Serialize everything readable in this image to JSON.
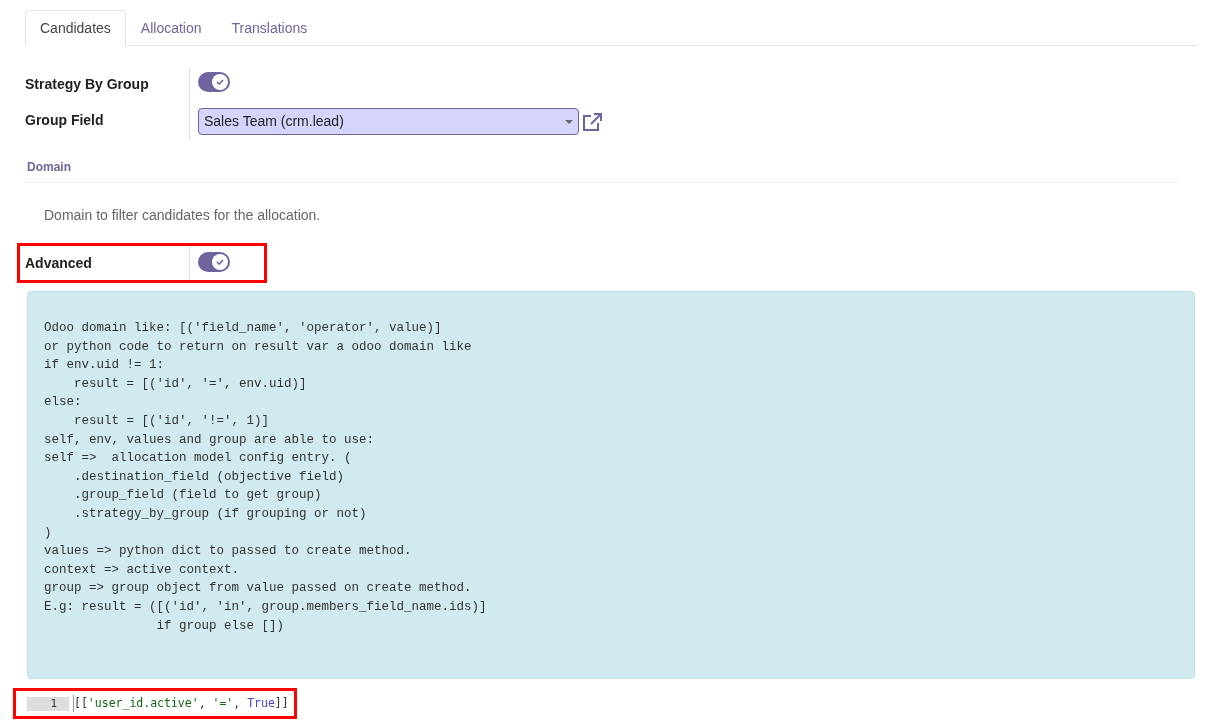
{
  "tabs": [
    {
      "label": "Candidates",
      "selected": true
    },
    {
      "label": "Allocation",
      "selected": false
    },
    {
      "label": "Translations",
      "selected": false
    }
  ],
  "fields": [
    {
      "label": "Strategy By Group",
      "kind": "toggle",
      "on": true
    },
    {
      "label": "Group Field",
      "kind": "select",
      "value": "Sales Team (crm.lead)"
    }
  ],
  "domain_section": {
    "title": "Domain",
    "description": "Domain to filter candidates for the allocation.",
    "advanced": {
      "label": "Advanced",
      "on": true
    },
    "help_lines": [
      "Odoo domain like: [('field_name', 'operator', value)]",
      "or python code to return on result var a odoo domain like",
      "if env.uid != 1:",
      "    result = [('id', '=', env.uid)]",
      "else:",
      "    result = [('id', '!=', 1)]",
      "self, env, values and group are able to use:",
      "self =>  allocation model config entry. (",
      "    .destination_field (objective field)",
      "    .group_field (field to get group)",
      "    .strategy_by_group (if grouping or not)",
      ")",
      "values => python dict to passed to create method.",
      "context => active context.",
      "group => group object from value passed on create method.",
      "E.g: result = ([('id', 'in', group.members_field_name.ids)]",
      "               if group else [])"
    ],
    "code_editor": {
      "line_number": "1",
      "tokens": [
        {
          "text": "[[",
          "kind": "punct"
        },
        {
          "text": "'user_id.active'",
          "kind": "string"
        },
        {
          "text": ", ",
          "kind": "punct"
        },
        {
          "text": "'='",
          "kind": "string"
        },
        {
          "text": ", ",
          "kind": "punct"
        },
        {
          "text": "True",
          "kind": "constant"
        },
        {
          "text": "]]",
          "kind": "punct"
        }
      ]
    }
  }
}
